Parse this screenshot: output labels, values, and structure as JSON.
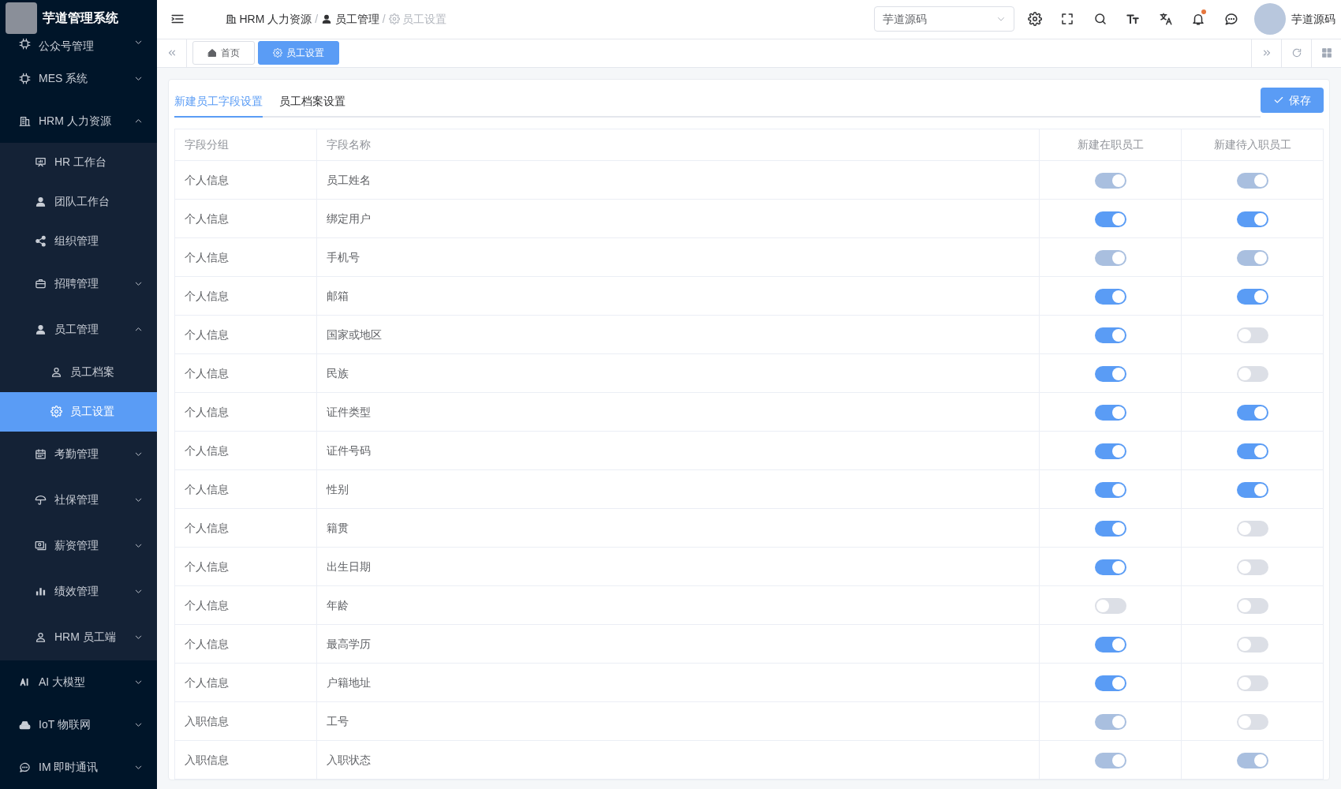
{
  "app": {
    "title": "芋道管理系统"
  },
  "sidebar": {
    "items": [
      {
        "label": "公众号管理",
        "expanded": false,
        "selected": false
      },
      {
        "label": "MES 系统",
        "expanded": false,
        "selected": false
      },
      {
        "label": "HRM 人力资源",
        "expanded": true,
        "selected": false,
        "children": [
          {
            "label": "HR 工作台",
            "selected": false
          },
          {
            "label": "团队工作台",
            "selected": false
          },
          {
            "label": "组织管理",
            "selected": false
          },
          {
            "label": "招聘管理",
            "expanded": false,
            "selected": false
          },
          {
            "label": "员工管理",
            "expanded": true,
            "selected": false,
            "children": [
              {
                "label": "员工档案",
                "selected": false
              },
              {
                "label": "员工设置",
                "selected": true
              }
            ]
          },
          {
            "label": "考勤管理",
            "expanded": false,
            "selected": false
          },
          {
            "label": "社保管理",
            "expanded": false,
            "selected": false
          },
          {
            "label": "薪资管理",
            "expanded": false,
            "selected": false
          },
          {
            "label": "绩效管理",
            "expanded": false,
            "selected": false
          },
          {
            "label": "HRM 员工端",
            "expanded": false,
            "selected": false
          }
        ]
      },
      {
        "label": "AI 大模型",
        "expanded": false,
        "selected": false
      },
      {
        "label": "IoT 物联网",
        "expanded": false,
        "selected": false
      },
      {
        "label": "IM 即时通讯",
        "expanded": false,
        "selected": false
      }
    ]
  },
  "header": {
    "breadcrumb_separator": "/",
    "breadcrumb": [
      {
        "label": "HRM 人力资源",
        "current": false
      },
      {
        "label": "员工管理",
        "current": false
      },
      {
        "label": "员工设置",
        "current": true
      }
    ],
    "tenant_select": {
      "value": "芋道源码"
    },
    "notifications": {
      "unread": true
    },
    "user": {
      "name": "芋道源码"
    }
  },
  "tabs_bar": {
    "tabs": [
      {
        "label": "首页",
        "selected": false
      },
      {
        "label": "员工设置",
        "selected": true
      }
    ]
  },
  "page": {
    "tabs": [
      {
        "label": "新建员工字段设置",
        "selected": true
      },
      {
        "label": "员工档案设置",
        "selected": false
      }
    ],
    "save_button": "保存",
    "table": {
      "columns": [
        "字段分组",
        "字段名称",
        "新建在职员工",
        "新建待入职员工"
      ],
      "rows": [
        {
          "group": "个人信息",
          "field": "员工姓名",
          "active": {
            "on": true,
            "disabled": true
          },
          "pending": {
            "on": true,
            "disabled": true
          }
        },
        {
          "group": "个人信息",
          "field": "绑定用户",
          "active": {
            "on": true,
            "disabled": false
          },
          "pending": {
            "on": true,
            "disabled": false
          }
        },
        {
          "group": "个人信息",
          "field": "手机号",
          "active": {
            "on": true,
            "disabled": true
          },
          "pending": {
            "on": true,
            "disabled": true
          }
        },
        {
          "group": "个人信息",
          "field": "邮箱",
          "active": {
            "on": true,
            "disabled": false
          },
          "pending": {
            "on": true,
            "disabled": false
          }
        },
        {
          "group": "个人信息",
          "field": "国家或地区",
          "active": {
            "on": true,
            "disabled": false
          },
          "pending": {
            "on": false,
            "disabled": false
          }
        },
        {
          "group": "个人信息",
          "field": "民族",
          "active": {
            "on": true,
            "disabled": false
          },
          "pending": {
            "on": false,
            "disabled": false
          }
        },
        {
          "group": "个人信息",
          "field": "证件类型",
          "active": {
            "on": true,
            "disabled": false
          },
          "pending": {
            "on": true,
            "disabled": false
          }
        },
        {
          "group": "个人信息",
          "field": "证件号码",
          "active": {
            "on": true,
            "disabled": false
          },
          "pending": {
            "on": true,
            "disabled": false
          }
        },
        {
          "group": "个人信息",
          "field": "性别",
          "active": {
            "on": true,
            "disabled": false
          },
          "pending": {
            "on": true,
            "disabled": false
          }
        },
        {
          "group": "个人信息",
          "field": "籍贯",
          "active": {
            "on": true,
            "disabled": false
          },
          "pending": {
            "on": false,
            "disabled": false
          }
        },
        {
          "group": "个人信息",
          "field": "出生日期",
          "active": {
            "on": true,
            "disabled": false
          },
          "pending": {
            "on": false,
            "disabled": false
          }
        },
        {
          "group": "个人信息",
          "field": "年龄",
          "active": {
            "on": false,
            "disabled": false
          },
          "pending": {
            "on": false,
            "disabled": false
          }
        },
        {
          "group": "个人信息",
          "field": "最高学历",
          "active": {
            "on": true,
            "disabled": false
          },
          "pending": {
            "on": false,
            "disabled": false
          }
        },
        {
          "group": "个人信息",
          "field": "户籍地址",
          "active": {
            "on": true,
            "disabled": false
          },
          "pending": {
            "on": false,
            "disabled": false
          }
        },
        {
          "group": "入职信息",
          "field": "工号",
          "active": {
            "on": true,
            "disabled": true
          },
          "pending": {
            "on": false,
            "disabled": false
          }
        },
        {
          "group": "入职信息",
          "field": "入职状态",
          "active": {
            "on": true,
            "disabled": true
          },
          "pending": {
            "on": true,
            "disabled": true
          }
        }
      ]
    }
  }
}
